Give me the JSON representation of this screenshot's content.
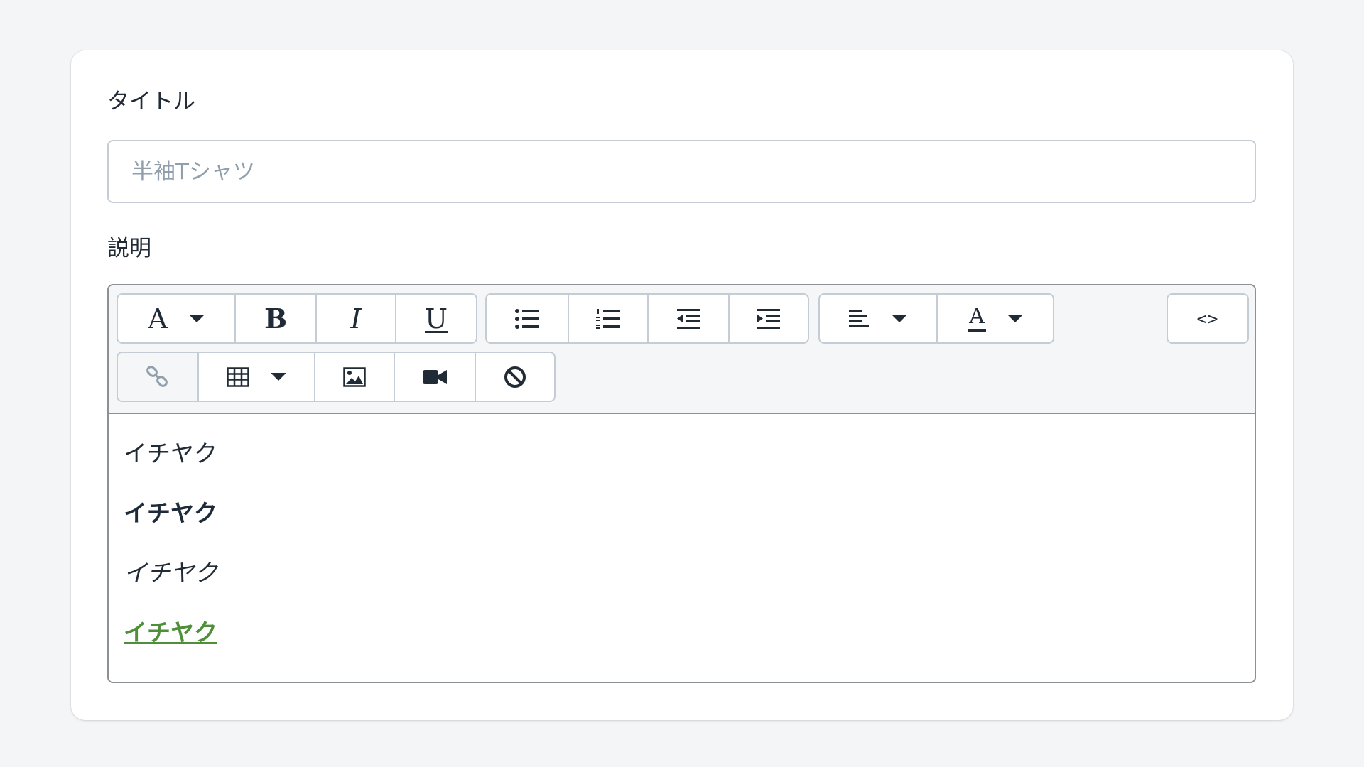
{
  "form": {
    "title_label": "タイトル",
    "title_placeholder": "半袖Tシャツ",
    "title_value": "",
    "description_label": "説明"
  },
  "toolbar": {
    "row1": [
      {
        "name": "text-style-dropdown",
        "glyph": "A",
        "dropdown": true
      },
      {
        "name": "bold-button",
        "glyph": "B"
      },
      {
        "name": "italic-button",
        "glyph": "I"
      },
      {
        "name": "underline-button",
        "glyph": "U"
      },
      {
        "name": "bulleted-list-button",
        "icon": "bulleted-list-icon"
      },
      {
        "name": "numbered-list-button",
        "icon": "numbered-list-icon"
      },
      {
        "name": "outdent-button",
        "icon": "outdent-icon"
      },
      {
        "name": "indent-button",
        "icon": "indent-icon"
      },
      {
        "name": "align-dropdown",
        "icon": "align-left-icon",
        "dropdown": true
      },
      {
        "name": "text-color-dropdown",
        "glyph": "A",
        "icon": "text-color-icon",
        "dropdown": true
      }
    ],
    "source_button_label": "<>",
    "row2": [
      {
        "name": "link-button",
        "icon": "link-icon",
        "disabled": true
      },
      {
        "name": "table-dropdown",
        "icon": "table-icon",
        "dropdown": true
      },
      {
        "name": "image-button",
        "icon": "image-icon"
      },
      {
        "name": "video-button",
        "icon": "video-camera-icon"
      },
      {
        "name": "clear-formatting-button",
        "icon": "clear-formatting-icon"
      }
    ],
    "glyphs": {
      "text_style": "A",
      "bold": "B",
      "italic": "I",
      "underline": "U",
      "text_color": "A"
    }
  },
  "content": {
    "lines": [
      {
        "text": "イチヤク",
        "style": "normal"
      },
      {
        "text": "イチヤク",
        "style": "bold"
      },
      {
        "text": "イチヤク",
        "style": "italic"
      },
      {
        "text": "イチヤク",
        "style": "link"
      }
    ]
  },
  "colors": {
    "link_text": "#4f8f3a",
    "bold_text": "#1c2a3a",
    "border": "#c4cdd5",
    "disabled_icon": "#919eab"
  }
}
